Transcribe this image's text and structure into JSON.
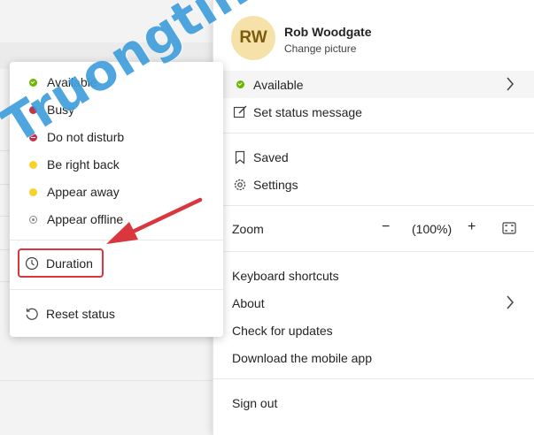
{
  "profile": {
    "initials": "RW",
    "name": "Rob Woodgate",
    "change_picture": "Change picture"
  },
  "profile_menu": {
    "current_status": "Available",
    "set_status_message": "Set status message",
    "saved": "Saved",
    "settings": "Settings",
    "zoom": {
      "label": "Zoom",
      "minus": "−",
      "value": "(100%)",
      "plus": "+"
    },
    "keyboard_shortcuts": "Keyboard shortcuts",
    "about": "About",
    "check_for_updates": "Check for updates",
    "download_mobile_app": "Download the mobile app",
    "sign_out": "Sign out"
  },
  "status_menu": {
    "items": [
      {
        "label": "Available",
        "status": "available",
        "color": "#6bb700"
      },
      {
        "label": "Busy",
        "status": "busy",
        "color": "#c4314b"
      },
      {
        "label": "Do not disturb",
        "status": "dnd",
        "color": "#c4314b"
      },
      {
        "label": "Be right back",
        "status": "away",
        "color": "#f8d22a"
      },
      {
        "label": "Appear away",
        "status": "away",
        "color": "#f8d22a"
      },
      {
        "label": "Appear offline",
        "status": "offline",
        "color": "#8a8a8a"
      }
    ],
    "duration": "Duration",
    "reset_status": "Reset status"
  },
  "watermark": "Truongtin.top",
  "colors": {
    "highlight_box": "#d9363e",
    "arrow": "#d9363e",
    "watermark": "#2891d7"
  }
}
